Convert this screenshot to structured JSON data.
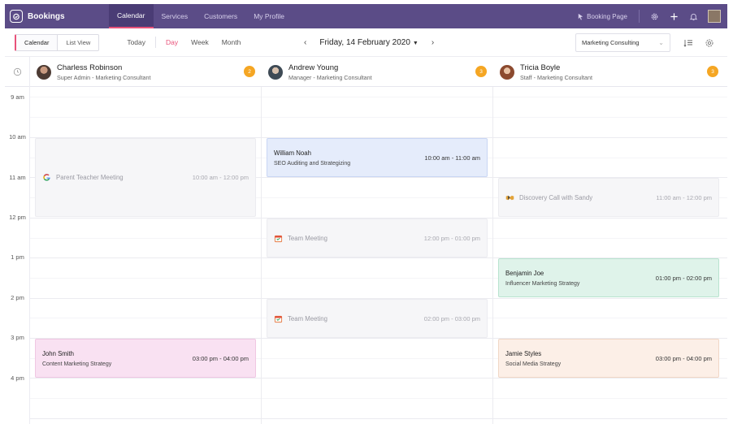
{
  "app": {
    "name": "Bookings"
  },
  "nav": {
    "items": [
      {
        "label": "Calendar",
        "active": true
      },
      {
        "label": "Services",
        "active": false
      },
      {
        "label": "Customers",
        "active": false
      },
      {
        "label": "My Profile",
        "active": false
      }
    ],
    "booking_page_label": "Booking Page"
  },
  "toolbar": {
    "view_calendar": "Calendar",
    "view_list": "List View",
    "today": "Today",
    "day": "Day",
    "week": "Week",
    "month": "Month",
    "date": "Friday, 14 February 2020",
    "service_select": "Marketing Consulting"
  },
  "staff": [
    {
      "name": "Charless Robinson",
      "role": "Super Admin - Marketing Consultant",
      "count": "2"
    },
    {
      "name": "Andrew Young",
      "role": "Manager - Marketing Consultant",
      "count": "3"
    },
    {
      "name": "Tricia Boyle",
      "role": "Staff - Marketing Consultant",
      "count": "3"
    }
  ],
  "hours": [
    "9 am",
    "10 am",
    "11 am",
    "12 pm",
    "1 pm",
    "2 pm",
    "3 pm",
    "4 pm"
  ],
  "events": {
    "col0_parent": {
      "title": "Parent Teacher Meeting",
      "time": "10:00 am - 12:00 pm",
      "icon": "google-icon"
    },
    "col0_john": {
      "name": "John Smith",
      "service": "Content Marketing Strategy",
      "time": "03:00 pm - 04:00 pm"
    },
    "col1_william": {
      "name": "William Noah",
      "service": "SEO Auditing and Strategizing",
      "time": "10:00 am - 11:00 am"
    },
    "col1_team1": {
      "title": "Team Meeting",
      "time": "12:00 pm - 01:00 pm",
      "icon": "calendar-icon"
    },
    "col1_team2": {
      "title": "Team Meeting",
      "time": "02:00 pm - 03:00 pm",
      "icon": "calendar-icon"
    },
    "col2_discovery": {
      "title": "Discovery Call with Sandy",
      "time": "11:00 am - 12:00 pm",
      "icon": "handshake-icon"
    },
    "col2_benjamin": {
      "name": "Benjamin Joe",
      "service": "Influencer Marketing Strategy",
      "time": "01:00 pm - 02:00 pm"
    },
    "col2_jamie": {
      "name": "Jamie Styles",
      "service": "Social Media Strategy",
      "time": "03:00 pm - 04:00 pm"
    }
  },
  "colors": {
    "nav_bg": "#5b4c87",
    "accent": "#e8527a",
    "badge": "#f5a623",
    "event_blue": "#e5ecfb",
    "event_green": "#dff3ea",
    "event_pink": "#f9e1f2",
    "event_peach": "#fcefe7",
    "event_gray": "#f6f6f8"
  }
}
